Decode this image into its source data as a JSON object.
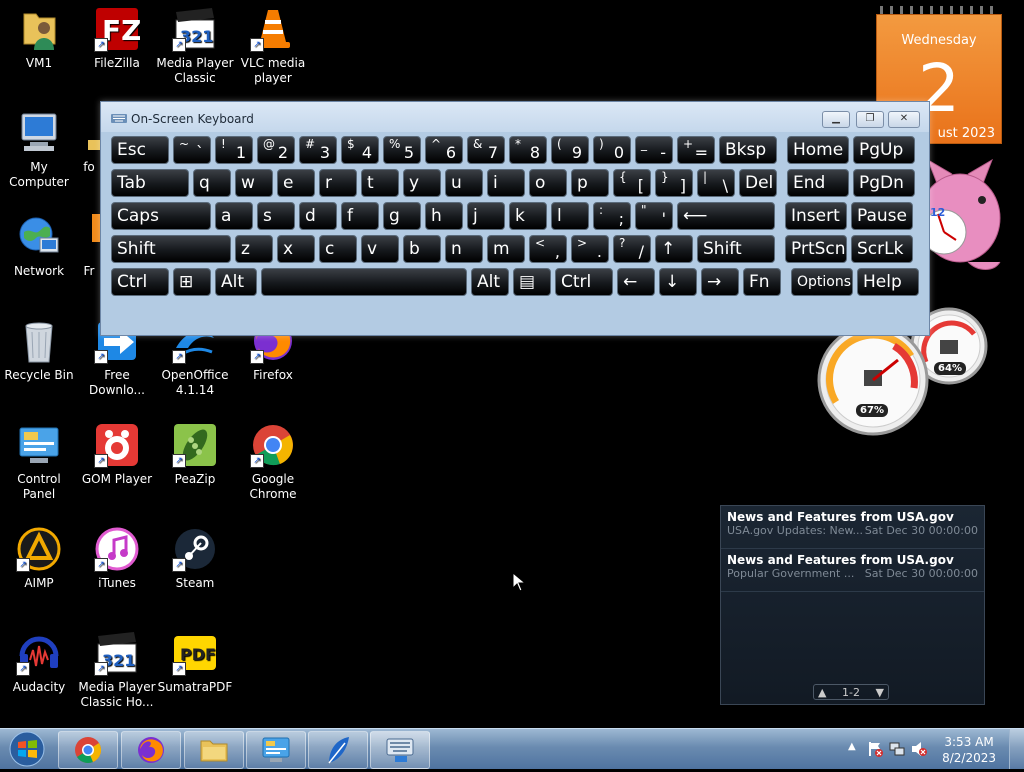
{
  "desktop_icons": [
    {
      "label": "VM1"
    },
    {
      "label": "FileZilla"
    },
    {
      "label": "Media Player Classic"
    },
    {
      "label": "VLC media player"
    },
    {
      "label": "My Computer"
    },
    {
      "label": "fo"
    },
    {
      "label": "Network"
    },
    {
      "label": "Fr"
    },
    {
      "label": "Recycle Bin"
    },
    {
      "label": "Free Downlo..."
    },
    {
      "label": "OpenOffice 4.1.14"
    },
    {
      "label": "Firefox"
    },
    {
      "label": "Control Panel"
    },
    {
      "label": "GOM Player"
    },
    {
      "label": "PeaZip"
    },
    {
      "label": "Google Chrome"
    },
    {
      "label": "AIMP"
    },
    {
      "label": "iTunes"
    },
    {
      "label": "Steam"
    },
    {
      "label": "Audacity"
    },
    {
      "label": "Media Player Classic Ho..."
    },
    {
      "label": "SumatraPDF"
    }
  ],
  "calendar": {
    "weekday": "Wednesday",
    "day": "2",
    "month_year": "ust 2023"
  },
  "cpu_meter": {
    "cpu": "67%",
    "memory": "64%"
  },
  "feed": {
    "items": [
      {
        "title": "News and Features from USA.gov",
        "summary": "USA.gov Updates: New...",
        "date": "Sat Dec 30 00:00:00"
      },
      {
        "title": "News and Features from USA.gov",
        "summary": "Popular Government ...",
        "date": "Sat Dec 30 00:00:00"
      }
    ],
    "page": "1-2"
  },
  "osk": {
    "title": "On-Screen Keyboard",
    "rows": [
      [
        {
          "l": "Esc"
        },
        {
          "u": "~",
          "o": "`"
        },
        {
          "u": "!",
          "o": "1"
        },
        {
          "u": "@",
          "o": "2"
        },
        {
          "u": "#",
          "o": "3"
        },
        {
          "u": "$",
          "o": "4"
        },
        {
          "u": "%",
          "o": "5"
        },
        {
          "u": "^",
          "o": "6"
        },
        {
          "u": "&",
          "o": "7"
        },
        {
          "u": "*",
          "o": "8"
        },
        {
          "u": "(",
          "o": "9"
        },
        {
          "u": ")",
          "o": "0"
        },
        {
          "u": "_",
          "o": "-"
        },
        {
          "u": "+",
          "o": "="
        },
        {
          "l": "Bksp"
        },
        {
          "l": "Home"
        },
        {
          "l": "PgUp"
        }
      ],
      [
        {
          "l": "Tab"
        },
        {
          "l": "q"
        },
        {
          "l": "w"
        },
        {
          "l": "e"
        },
        {
          "l": "r"
        },
        {
          "l": "t"
        },
        {
          "l": "y"
        },
        {
          "l": "u"
        },
        {
          "l": "i"
        },
        {
          "l": "o"
        },
        {
          "l": "p"
        },
        {
          "u": "{",
          "o": "["
        },
        {
          "u": "}",
          "o": "]"
        },
        {
          "u": "|",
          "o": "\\"
        },
        {
          "l": "Del"
        },
        {
          "l": "End"
        },
        {
          "l": "PgDn"
        }
      ],
      [
        {
          "l": "Caps"
        },
        {
          "l": "a"
        },
        {
          "l": "s"
        },
        {
          "l": "d"
        },
        {
          "l": "f"
        },
        {
          "l": "g"
        },
        {
          "l": "h"
        },
        {
          "l": "j"
        },
        {
          "l": "k"
        },
        {
          "l": "l"
        },
        {
          "u": ":",
          "o": ";"
        },
        {
          "u": "\"",
          "o": "'"
        },
        {
          "l": "⟵"
        },
        {
          "l": "Insert"
        },
        {
          "l": "Pause"
        }
      ],
      [
        {
          "l": "Shift"
        },
        {
          "l": "z"
        },
        {
          "l": "x"
        },
        {
          "l": "c"
        },
        {
          "l": "v"
        },
        {
          "l": "b"
        },
        {
          "l": "n"
        },
        {
          "l": "m"
        },
        {
          "u": "<",
          "o": ","
        },
        {
          "u": ">",
          "o": "."
        },
        {
          "u": "?",
          "o": "/"
        },
        {
          "l": "↑"
        },
        {
          "l": "Shift"
        },
        {
          "l": "PrtScn"
        },
        {
          "l": "ScrLk"
        }
      ],
      [
        {
          "l": "Ctrl"
        },
        {
          "l": "⊞"
        },
        {
          "l": "Alt"
        },
        {
          "l": ""
        },
        {
          "l": "Alt"
        },
        {
          "l": "▤"
        },
        {
          "l": "Ctrl"
        },
        {
          "l": "←"
        },
        {
          "l": "↓"
        },
        {
          "l": "→"
        },
        {
          "l": "Fn"
        },
        {
          "l": "Options"
        },
        {
          "l": "Help"
        }
      ]
    ]
  },
  "taskbar": {
    "apps": [
      "Google Chrome",
      "Firefox",
      "Windows Explorer",
      "Control Panel",
      "Feather app",
      "On-Screen Keyboard"
    ],
    "time": "3:53 AM",
    "date": "8/2/2023"
  }
}
